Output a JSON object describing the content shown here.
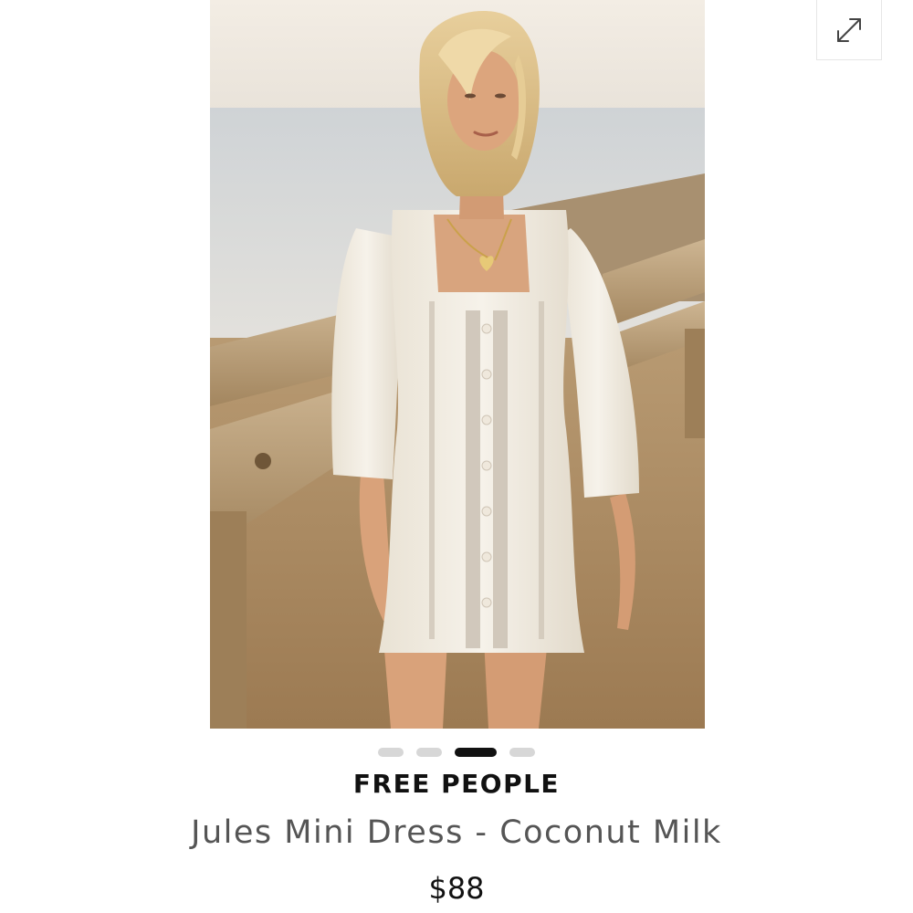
{
  "gallery": {
    "image_alt": "Model wearing a white square-neck mini dress with lace inserts and puff sleeves by the ocean",
    "expand_icon": "expand-diagonal-arrows-icon",
    "dots": [
      {
        "active": false
      },
      {
        "active": false
      },
      {
        "active": true
      },
      {
        "active": false
      }
    ]
  },
  "product": {
    "brand": "FREE PEOPLE",
    "name": "Jules Mini Dress - Coconut Milk",
    "price": "$88"
  },
  "colors": {
    "text_primary": "#111111",
    "text_secondary": "#555555",
    "dot_inactive": "#d7d7d7",
    "dot_active": "#111111"
  }
}
